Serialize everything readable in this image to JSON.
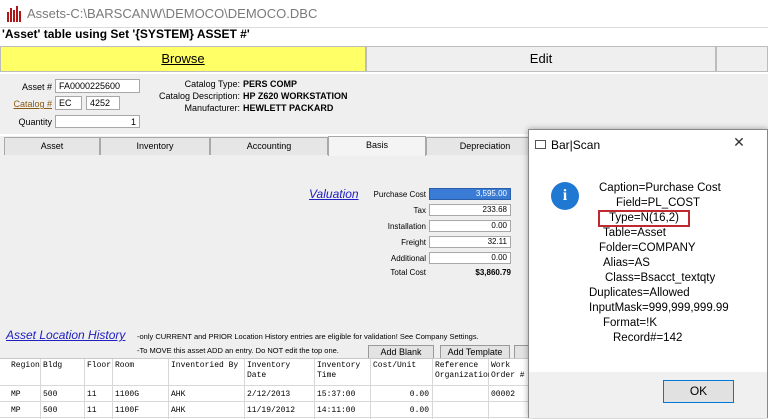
{
  "window": {
    "title": "Assets-C:\\BARSCANW\\DEMOCO\\DEMOCO.DBC",
    "subtitle": "'Asset' table using Set '{SYSTEM} ASSET #'"
  },
  "mode_tabs": {
    "browse": "Browse",
    "edit": "Edit"
  },
  "header": {
    "asset_label": "Asset #",
    "asset_value": "FA0000225600",
    "catalog_label": "Catalog #",
    "catalog_prefix": "EC",
    "catalog_value": "4252",
    "quantity_label": "Quantity",
    "quantity_value": "1",
    "catalog_type_label": "Catalog Type:",
    "catalog_type_value": "PERS COMP",
    "catalog_desc_label": "Catalog Description:",
    "catalog_desc_value": "HP Z620 WORKSTATION",
    "manufacturer_label": "Manufacturer:",
    "manufacturer_value": "HEWLETT PACKARD"
  },
  "sub_tabs": [
    "Asset",
    "Inventory",
    "Accounting",
    "Basis",
    "Depreciation"
  ],
  "valuation": {
    "title": "Valuation",
    "rows": [
      {
        "label": "Purchase Cost",
        "value": "3,595.00"
      },
      {
        "label": "Tax",
        "value": "233.68"
      },
      {
        "label": "Installation",
        "value": "0.00"
      },
      {
        "label": "Freight",
        "value": "32.11"
      },
      {
        "label": "Additional",
        "value": "0.00"
      }
    ],
    "total_label": "Total Cost",
    "total_value": "$3,860.79"
  },
  "history": {
    "title": "Asset Location History",
    "note1": "-only CURRENT and PRIOR Location History entries are eligible for validation! See Company Settings.",
    "note2": "-To MOVE this asset ADD an entry. Do NOT edit the top one.",
    "add_blank": "Add Blank",
    "add_template": "Add Template"
  },
  "grid": {
    "headers": [
      "Region",
      "Bldg",
      "Floor",
      "Room",
      "Inventoried By",
      "Inventory Date",
      "Inventory Time",
      "Cost/Unit",
      "Reference Organization",
      "Work Order #"
    ],
    "rows": [
      [
        "MP",
        "500",
        "11",
        "1100G",
        "AHK",
        "2/12/2013",
        "15:37:00",
        "0.00",
        "",
        "00002"
      ],
      [
        "MP",
        "500",
        "11",
        "1100F",
        "AHK",
        "11/19/2012",
        "14:11:00",
        "0.00",
        "",
        ""
      ]
    ]
  },
  "dialog": {
    "title": "Bar|Scan",
    "lines": [
      "Caption=Purchase Cost",
      "Field=PL_COST",
      "Type=N(16,2)",
      "Table=Asset",
      "Folder=COMPANY",
      "Alias=AS",
      "Class=Bsacct_textqty",
      "Duplicates=Allowed",
      "InputMask=999,999,999.99",
      "Format=!K",
      "Record#=142"
    ],
    "ok": "OK"
  },
  "colors": {
    "browse_tab": "#ffff66",
    "link": "#2020c0",
    "highlight": "#c0292f",
    "info": "#1f78d1",
    "selected_field": "#3a7bd5"
  }
}
